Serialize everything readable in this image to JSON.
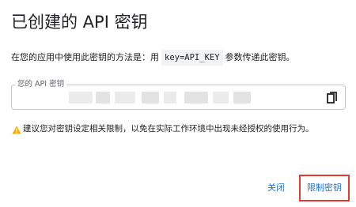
{
  "dialog": {
    "title": "已创建的 API 密钥",
    "description_prefix": "在您的应用中使用此密钥的方法是：用",
    "description_code": "key=API_KEY",
    "description_suffix": "参数传递此密钥。",
    "key_field": {
      "label": "您的 API 密钥",
      "value_masked": true,
      "copy_icon": "copy-icon"
    },
    "warning": {
      "icon": "warning-icon",
      "text": "建议您对密钥设定相关限制，以免在实际工作环境中出现未经授权的使用行为。",
      "icon_color": "#f9ab00"
    },
    "actions": {
      "close_label": "关闭",
      "restrict_label": "限制密钥"
    },
    "colors": {
      "accent": "#1a73e8",
      "highlight_border": "#e53935"
    }
  }
}
